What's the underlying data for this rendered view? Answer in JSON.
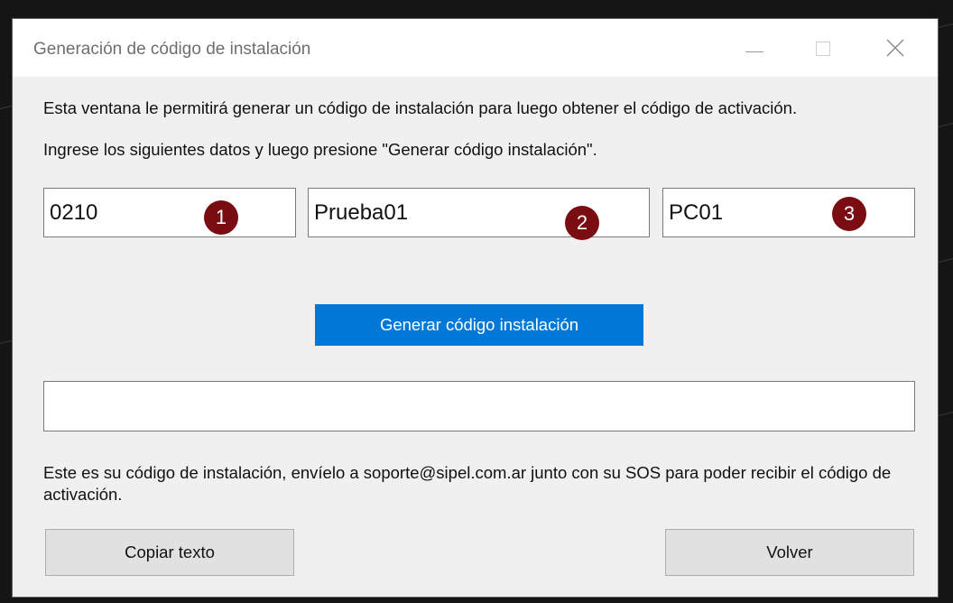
{
  "window": {
    "title": "Generación de código de instalación",
    "controls": [
      "minimize-icon",
      "maximize-icon",
      "close-icon"
    ]
  },
  "instructions": {
    "line1": "Esta ventana le permitirá generar un código de instalación para luego obtener el código de activación.",
    "line2": "Ingrese los siguientes datos y luego presione \"Generar código instalación\"."
  },
  "fields": [
    {
      "value": "0210",
      "badge": "1"
    },
    {
      "value": "Prueba01",
      "badge": "2"
    },
    {
      "value": "PC01",
      "badge": "3"
    }
  ],
  "generate_button": "Generar código instalación",
  "output": {
    "value": ""
  },
  "note": "Este es su código de instalación, envíelo a soporte@sipel.com.ar junto con su SOS para poder recibir el código de activación.",
  "buttons": {
    "copy": "Copiar texto",
    "back": "Volver"
  },
  "colors": {
    "accent": "#0078d7",
    "badge": "#7a0d12"
  }
}
